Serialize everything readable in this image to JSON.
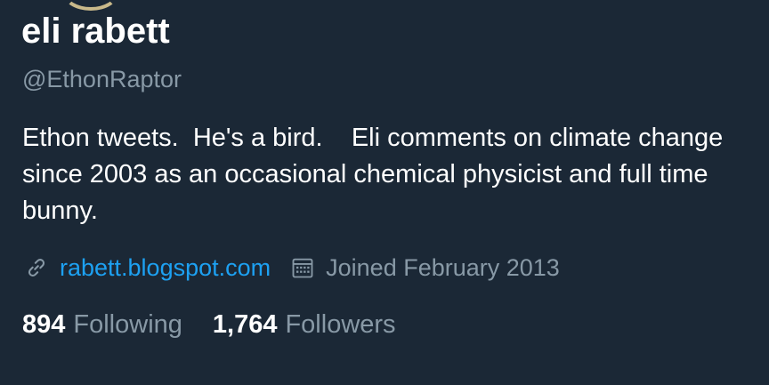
{
  "profile": {
    "display_name": "eli rabett",
    "handle": "@EthonRaptor",
    "bio": "Ethon tweets.  He's a bird.    Eli comments on climate change since 2003 as an occasional chemical physicist and full time bunny.",
    "website": "rabett.blogspot.com",
    "joined": "Joined February 2013",
    "following_count": "894",
    "following_label": "Following",
    "followers_count": "1,764",
    "followers_label": "Followers"
  },
  "icons": {
    "link": "link-icon",
    "calendar": "calendar-icon"
  },
  "colors": {
    "background": "#1b2836",
    "primary_text": "#ffffff",
    "secondary_text": "#8899a6",
    "link": "#1da1f2"
  }
}
